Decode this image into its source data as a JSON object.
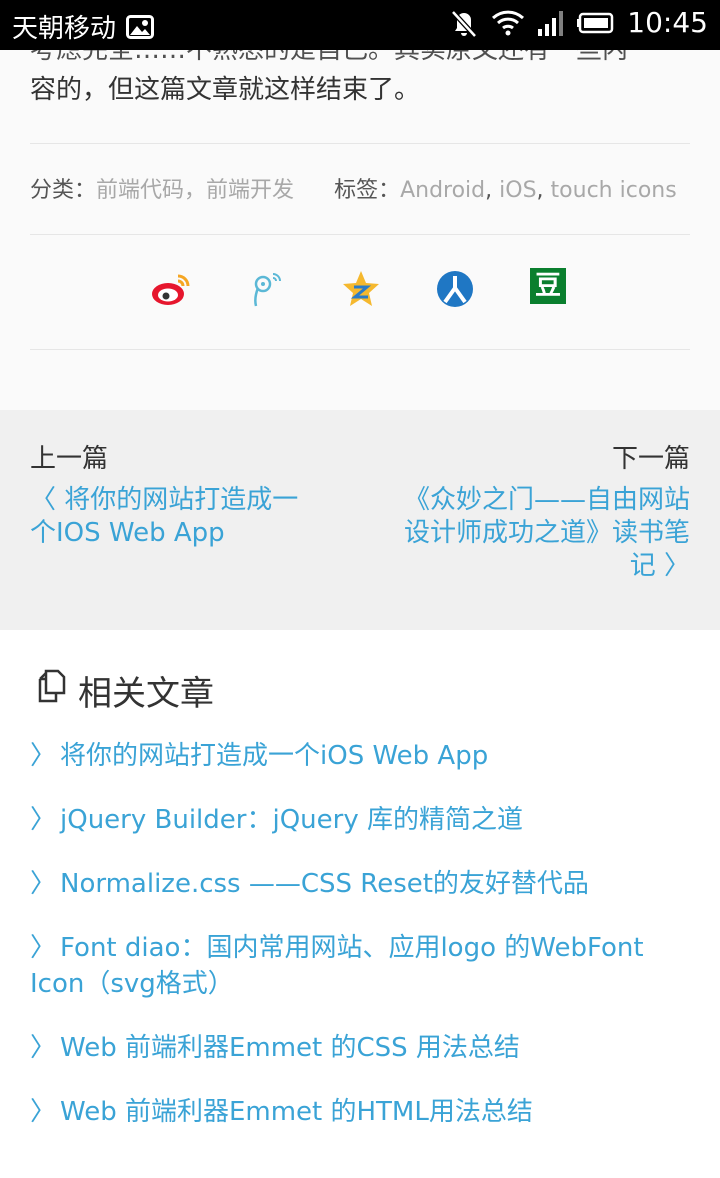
{
  "statusbar": {
    "carrier": "天朝移动",
    "time": "10:45"
  },
  "article": {
    "line1": "考虑完全……不熟悉的是自己。其实原文还有一些内",
    "line2": "容的，但这篇文章就这样结束了。"
  },
  "meta": {
    "category_label": "分类：",
    "categories": [
      "前端代码",
      "前端开发"
    ],
    "category_sep": "，",
    "tags_label": "标签：",
    "tags": [
      "Android",
      "iOS",
      "touch icons"
    ],
    "tag_sep": ", "
  },
  "share": {
    "icons": [
      "weibo-icon",
      "tencent-weibo-icon",
      "qzone-icon",
      "renren-icon",
      "douban-icon"
    ],
    "douban_glyph": "豆"
  },
  "prevnext": {
    "prev_label": "上一篇",
    "next_label": "下一篇",
    "prev_title_line1": "〈  将你的网站打造成一",
    "prev_title_line2": "个IOS Web App",
    "next_title_line1": "《众妙之门——自由网站",
    "next_title_line2": "设计师成功之道》读书笔",
    "next_title_line3": "记 〉"
  },
  "related": {
    "title": "相关文章",
    "items": [
      "将你的网站打造成一个iOS Web App",
      "jQuery Builder：jQuery 库的精简之道",
      "Normalize.css ——CSS Reset的友好替代品",
      "Font diao：国内常用网站、应用logo 的WebFont Icon（svg格式）",
      "Web 前端利器Emmet 的CSS 用法总结",
      "Web 前端利器Emmet 的HTML用法总结"
    ]
  },
  "colors": {
    "link": "#3aa3d6",
    "muted": "#a8a8a8",
    "panel": "#f0f0f0"
  }
}
